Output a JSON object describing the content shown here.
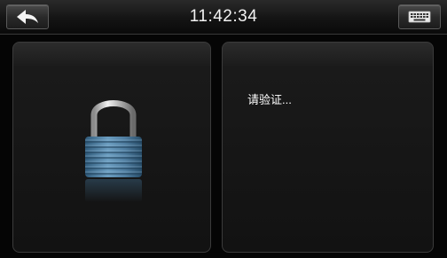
{
  "header": {
    "time": "11:42:34",
    "back_icon": "back-arrow-icon",
    "keyboard_icon": "keyboard-icon"
  },
  "left_panel": {
    "icon": "padlock-icon"
  },
  "right_panel": {
    "prompt": "请验证..."
  },
  "colors": {
    "background": "#050505",
    "panel": "#1a1a1a",
    "text": "#ffffff",
    "lock_body": "#4f7da0"
  }
}
